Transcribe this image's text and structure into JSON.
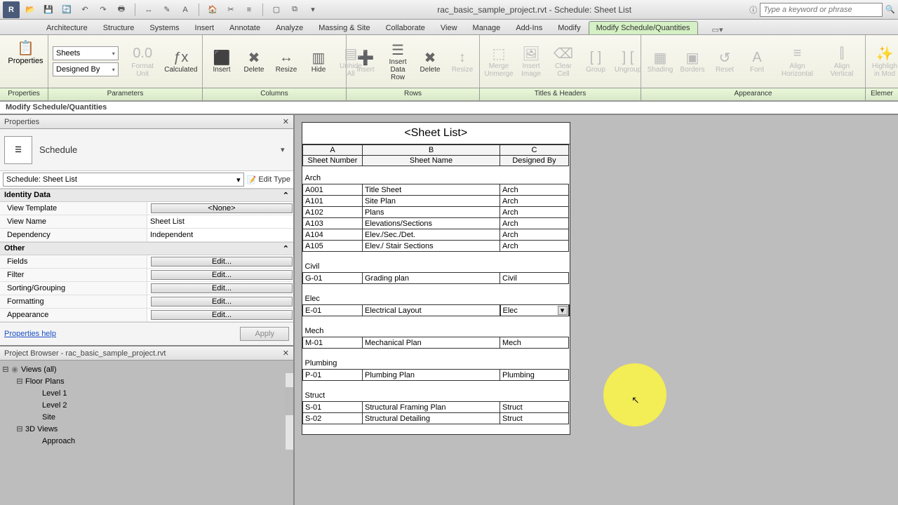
{
  "titlebar": {
    "title": "rac_basic_sample_project.rvt - Schedule: Sheet List",
    "search_placeholder": "Type a keyword or phrase"
  },
  "tabs": [
    "Architecture",
    "Structure",
    "Systems",
    "Insert",
    "Annotate",
    "Analyze",
    "Massing & Site",
    "Collaborate",
    "View",
    "Manage",
    "Add-Ins",
    "Modify",
    "Modify Schedule/Quantities"
  ],
  "active_tab": 12,
  "ribbon": {
    "properties_btn": "Properties",
    "selects": {
      "a": "Sheets",
      "b": "Designed By"
    },
    "buttons": {
      "format_unit": "Format\nUnit",
      "calculated": "Calculated",
      "c_insert": "Insert",
      "c_delete": "Delete",
      "c_resize": "Resize",
      "c_hide": "Hide",
      "c_unhide": "Unhide\nAll",
      "r_insert": "Insert",
      "r_datarow": "Insert\nData Row",
      "r_delete": "Delete",
      "r_resize": "Resize",
      "merge": "Merge\nUnmerge",
      "insert_image": "Insert\nImage",
      "clear_cell": "Clear\nCell",
      "group": "Group",
      "ungroup": "Ungroup",
      "shading": "Shading",
      "borders": "Borders",
      "reset": "Reset",
      "font": "Font",
      "alignh": "Align\nHorizontal",
      "alignv": "Align\nVertical",
      "high": "Highligh\nin Mod"
    },
    "labels": {
      "properties": "Properties",
      "parameters": "Parameters",
      "columns": "Columns",
      "rows": "Rows",
      "titles": "Titles & Headers",
      "appearance": "Appearance",
      "element": "Elemer"
    }
  },
  "context_label": "Modify Schedule/Quantities",
  "properties": {
    "title": "Properties",
    "type_name": "Schedule",
    "instance": "Schedule: Sheet List",
    "edit_type": "Edit Type",
    "cat_identity": "Identity Data",
    "view_template_k": "View Template",
    "view_template_v": "<None>",
    "view_name_k": "View Name",
    "view_name_v": "Sheet List",
    "dependency_k": "Dependency",
    "dependency_v": "Independent",
    "cat_other": "Other",
    "fields_k": "Fields",
    "filter_k": "Filter",
    "sorting_k": "Sorting/Grouping",
    "formatting_k": "Formatting",
    "appearance_k": "Appearance",
    "edit_btn": "Edit...",
    "help": "Properties help",
    "apply": "Apply"
  },
  "browser": {
    "title": "Project Browser - rac_basic_sample_project.rvt",
    "views_all": "Views (all)",
    "floor_plans": "Floor Plans",
    "level1": "Level 1",
    "level2": "Level 2",
    "site": "Site",
    "threed": "3D Views",
    "approach": "Approach"
  },
  "schedule": {
    "title": "<Sheet List>",
    "cols": {
      "a": "A",
      "b": "B",
      "c": "C"
    },
    "headers": {
      "a": "Sheet Number",
      "b": "Sheet Name",
      "c": "Designed By"
    },
    "groups": [
      {
        "name": "Arch",
        "rows": [
          {
            "a": "A001",
            "b": "Title Sheet",
            "c": "Arch"
          },
          {
            "a": "A101",
            "b": "Site Plan",
            "c": "Arch"
          },
          {
            "a": "A102",
            "b": "Plans",
            "c": "Arch"
          },
          {
            "a": "A103",
            "b": "Elevations/Sections",
            "c": "Arch"
          },
          {
            "a": "A104",
            "b": "Elev./Sec./Det.",
            "c": "Arch"
          },
          {
            "a": "A105",
            "b": "Elev./ Stair Sections",
            "c": "Arch"
          }
        ]
      },
      {
        "name": "Civil",
        "rows": [
          {
            "a": "G-01",
            "b": "Grading plan",
            "c": "Civil"
          }
        ]
      },
      {
        "name": "Elec",
        "rows": [
          {
            "a": "E-01",
            "b": "Electrical Layout",
            "c": "Elec",
            "sel": true
          }
        ]
      },
      {
        "name": "Mech",
        "rows": [
          {
            "a": "M-01",
            "b": "Mechanical Plan",
            "c": "Mech"
          }
        ]
      },
      {
        "name": "Plumbing",
        "rows": [
          {
            "a": "P-01",
            "b": "Plumbing Plan",
            "c": "Plumbing"
          }
        ]
      },
      {
        "name": "Struct",
        "rows": [
          {
            "a": "S-01",
            "b": "Structural Framing Plan",
            "c": "Struct"
          },
          {
            "a": "S-02",
            "b": "Structural Detailing",
            "c": "Struct"
          }
        ]
      }
    ]
  }
}
